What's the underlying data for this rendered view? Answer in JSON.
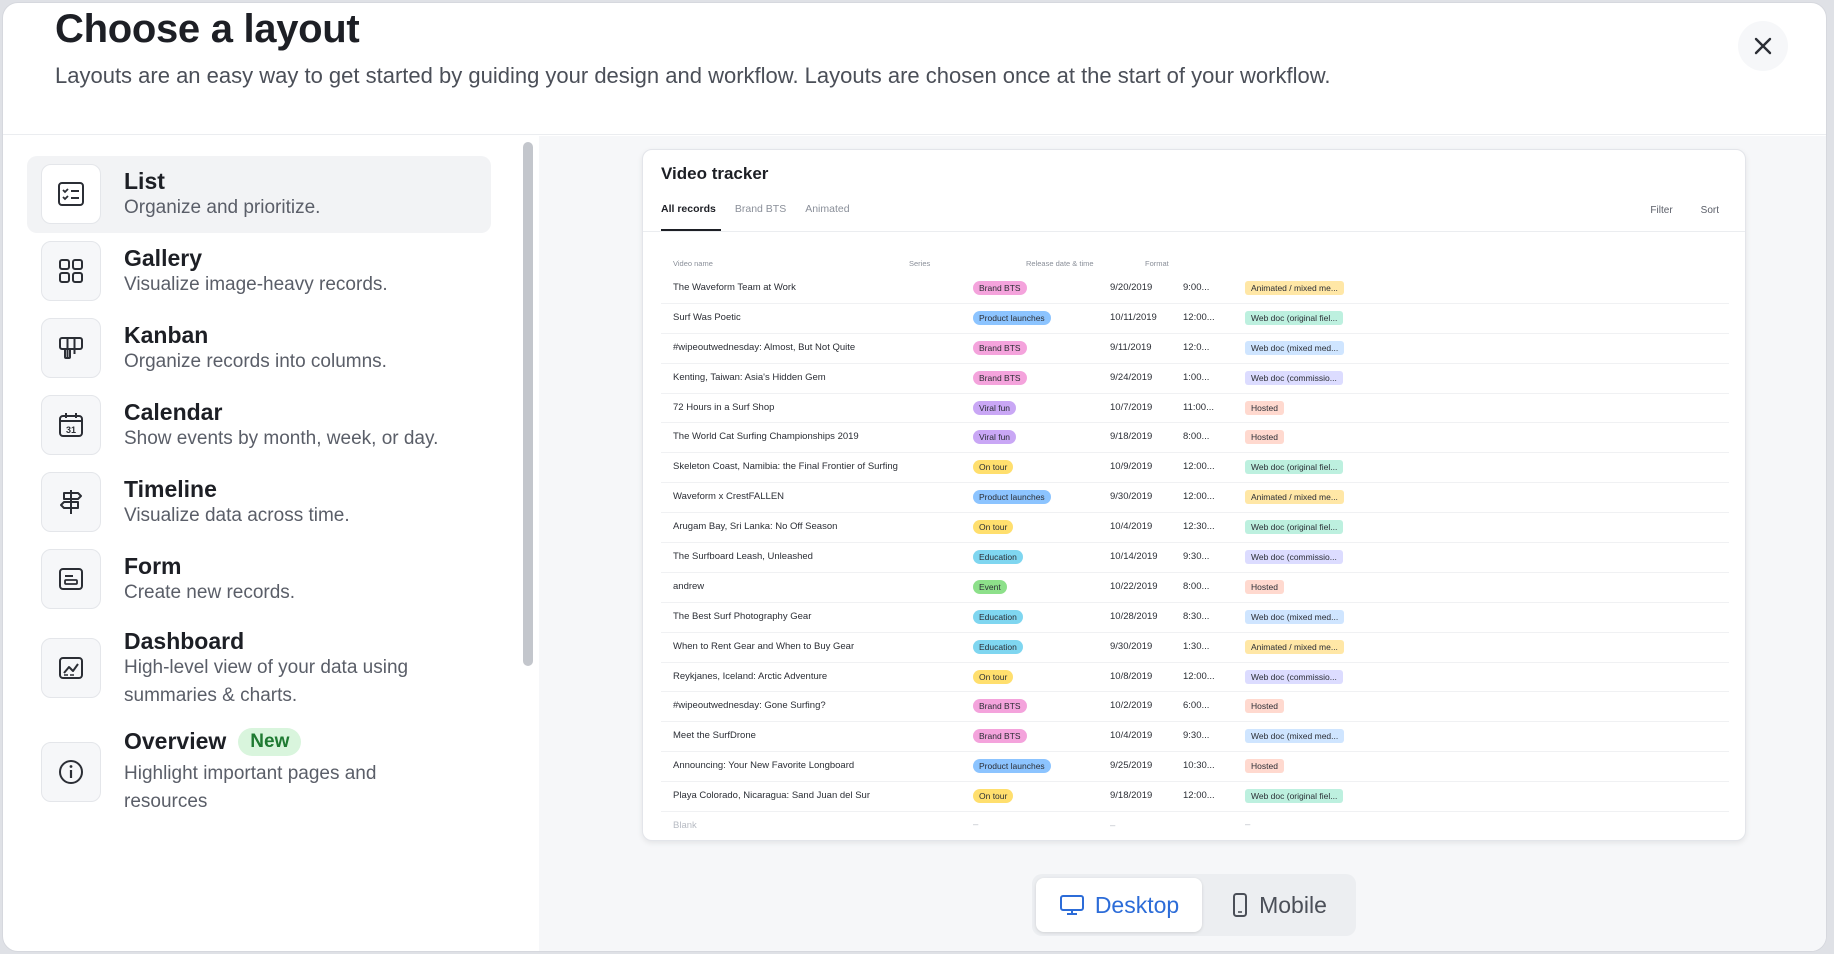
{
  "header": {
    "title": "Choose a layout",
    "subtitle": "Layouts are an easy way to get started by guiding your design and workflow. Layouts are chosen once at the start of your workflow."
  },
  "layouts": [
    {
      "name": "List",
      "description": "Organize and prioritize.",
      "icon": "list-checklist-icon",
      "selected": true
    },
    {
      "name": "Gallery",
      "description": "Visualize image-heavy records.",
      "icon": "gallery-grid-icon"
    },
    {
      "name": "Kanban",
      "description": "Organize records into columns.",
      "icon": "kanban-icon"
    },
    {
      "name": "Calendar",
      "description": "Show events by month, week, or day.",
      "icon": "calendar-icon"
    },
    {
      "name": "Timeline",
      "description": "Visualize data across time.",
      "icon": "timeline-signpost-icon"
    },
    {
      "name": "Form",
      "description": "Create new records.",
      "icon": "form-icon"
    },
    {
      "name": "Dashboard",
      "description": "High-level view of your data using summaries & charts.",
      "icon": "dashboard-chart-icon"
    },
    {
      "name": "Overview",
      "badge": "New",
      "description": "Highlight important pages and resources",
      "icon": "info-circle-icon"
    }
  ],
  "preview": {
    "title": "Video tracker",
    "tabs": [
      "All records",
      "Brand BTS",
      "Animated"
    ],
    "tools": [
      "Filter",
      "Sort"
    ],
    "columns": [
      "Video name",
      "Series",
      "Release date & time",
      "Format"
    ],
    "rows": [
      {
        "name": "The Waveform Team at Work",
        "series": "Brand BTS",
        "date": "9/20/2019",
        "time": "9:00...",
        "format": "Animated / mixed me..."
      },
      {
        "name": "Surf Was Poetic",
        "series": "Product launches",
        "date": "10/11/2019",
        "time": "12:00...",
        "format": "Web doc (original fiel..."
      },
      {
        "name": "#wipeoutwednesday: Almost, But Not Quite",
        "series": "Brand BTS",
        "date": "9/11/2019",
        "time": "12:0...",
        "format": "Web doc (mixed med..."
      },
      {
        "name": "Kenting, Taiwan: Asia's Hidden Gem",
        "series": "Brand BTS",
        "date": "9/24/2019",
        "time": "1:00...",
        "format": "Web doc (commissio..."
      },
      {
        "name": "72 Hours in a Surf Shop",
        "series": "Viral fun",
        "date": "10/7/2019",
        "time": "11:00...",
        "format": "Hosted"
      },
      {
        "name": "The World Cat Surfing Championships 2019",
        "series": "Viral fun",
        "date": "9/18/2019",
        "time": "8:00...",
        "format": "Hosted"
      },
      {
        "name": "Skeleton Coast, Namibia: the Final Frontier of Surfing",
        "series": "On tour",
        "date": "10/9/2019",
        "time": "12:00...",
        "format": "Web doc (original fiel..."
      },
      {
        "name": "Waveform x CrestFALLEN",
        "series": "Product launches",
        "date": "9/30/2019",
        "time": "12:00...",
        "format": "Animated / mixed me..."
      },
      {
        "name": "Arugam Bay, Sri Lanka: No Off Season",
        "series": "On tour",
        "date": "10/4/2019",
        "time": "12:30...",
        "format": "Web doc (original fiel..."
      },
      {
        "name": "The Surfboard Leash, Unleashed",
        "series": "Education",
        "date": "10/14/2019",
        "time": "9:30...",
        "format": "Web doc (commissio..."
      },
      {
        "name": "andrew",
        "series": "Event",
        "date": "10/22/2019",
        "time": "8:00...",
        "format": "Hosted"
      },
      {
        "name": "The Best Surf Photography Gear",
        "series": "Education",
        "date": "10/28/2019",
        "time": "8:30...",
        "format": "Web doc (mixed med..."
      },
      {
        "name": "When to Rent Gear and When to Buy Gear",
        "series": "Education",
        "date": "9/30/2019",
        "time": "1:30...",
        "format": "Animated / mixed me..."
      },
      {
        "name": "Reykjanes, Iceland: Arctic Adventure",
        "series": "On tour",
        "date": "10/8/2019",
        "time": "12:00...",
        "format": "Web doc (commissio..."
      },
      {
        "name": "#wipeoutwednesday: Gone Surfing?",
        "series": "Brand BTS",
        "date": "10/2/2019",
        "time": "6:00...",
        "format": "Hosted"
      },
      {
        "name": "Meet the SurfDrone",
        "series": "Brand BTS",
        "date": "10/4/2019",
        "time": "9:30...",
        "format": "Web doc (mixed med..."
      },
      {
        "name": "Announcing: Your New Favorite Longboard",
        "series": "Product launches",
        "date": "9/25/2019",
        "time": "10:30...",
        "format": "Hosted"
      },
      {
        "name": "Playa Colorado, Nicaragua: Sand Juan del Sur",
        "series": "On tour",
        "date": "9/18/2019",
        "time": "12:00...",
        "format": "Web doc (original fiel..."
      },
      {
        "name": "Blank",
        "series": "–",
        "date": "–",
        "time": "",
        "format": "–",
        "blank": true
      }
    ],
    "series_colors": {
      "Brand BTS": "#f4a3dc",
      "Product launches": "#8cc4ff",
      "Viral fun": "#c9a7f5",
      "On tour": "#ffdf6e",
      "Education": "#7fd6f0",
      "Event": "#8de08a"
    },
    "format_colors": {
      "Animated / mixed me...": "#ffe7a6",
      "Web doc (original fiel...": "#bdf0df",
      "Web doc (mixed med...": "#cfe5ff",
      "Web doc (commissio...": "#dcdcff",
      "Hosted": "#ffd9cf"
    }
  },
  "view_toggle": {
    "desktop_label": "Desktop",
    "mobile_label": "Mobile",
    "active": "Desktop"
  },
  "colors": {
    "accent": "#2c6cd8",
    "new_badge_bg": "#d9f5dd",
    "new_badge_text": "#1f7a32"
  }
}
